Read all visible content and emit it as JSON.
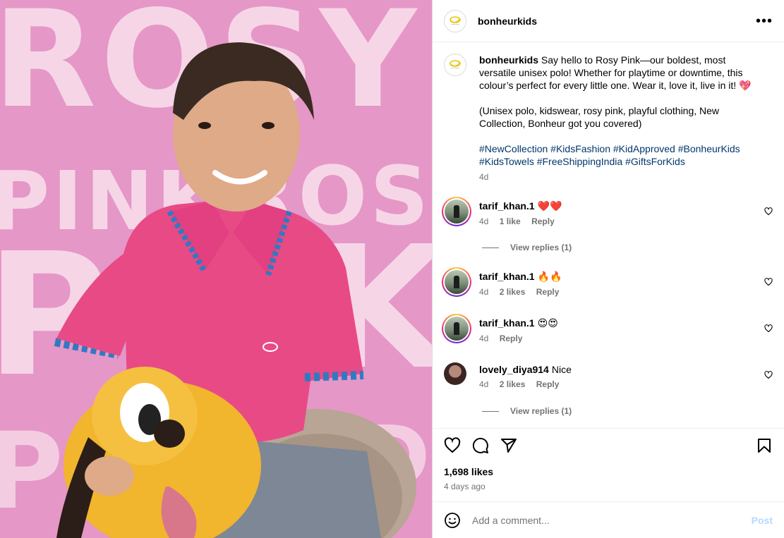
{
  "media": {
    "background_words": [
      "ROSY",
      "PINK",
      "ROS",
      "P",
      "K",
      "P",
      "DI"
    ],
    "colors": {
      "background": "#e597c7",
      "word": "#f6d6e6",
      "shirt": "#e84a86",
      "plush": "#f1b52e"
    }
  },
  "header": {
    "username": "bonheurkids",
    "more_label": "•••"
  },
  "caption": {
    "username": "bonheurkids",
    "text": "Say hello to Rosy Pink—our boldest, most versatile unisex polo! Whether for playtime or downtime, this colour’s perfect for every little one. Wear it, love it, live in it! 💖",
    "keywords": "(Unisex polo, kidswear, rosy pink, playful clothing, New Collection, Bonheur got you covered)",
    "hashtags": [
      "#NewCollection",
      "#KidsFashion",
      "#KidApproved",
      "#BonheurKids",
      "#KidsTowels",
      "#FreeShippingIndia",
      "#GiftsForKids"
    ],
    "time": "4d"
  },
  "comments": [
    {
      "username": "tarif_khan.1",
      "text": "❤️❤️",
      "time": "4d",
      "likes": "1 like",
      "reply": "Reply",
      "view_replies": "View replies (1)"
    },
    {
      "username": "tarif_khan.1",
      "text": "🔥🔥",
      "time": "4d",
      "likes": "2 likes",
      "reply": "Reply"
    },
    {
      "username": "tarif_khan.1",
      "text": "😍😍",
      "time": "4d",
      "reply": "Reply"
    },
    {
      "username": "lovely_diya914",
      "text": "Nice",
      "time": "4d",
      "likes": "2 likes",
      "reply": "Reply",
      "view_replies": "View replies (1)"
    }
  ],
  "footer": {
    "likes": "1,698 likes",
    "posted": "4 days ago",
    "comment_placeholder": "Add a comment...",
    "post_label": "Post"
  }
}
